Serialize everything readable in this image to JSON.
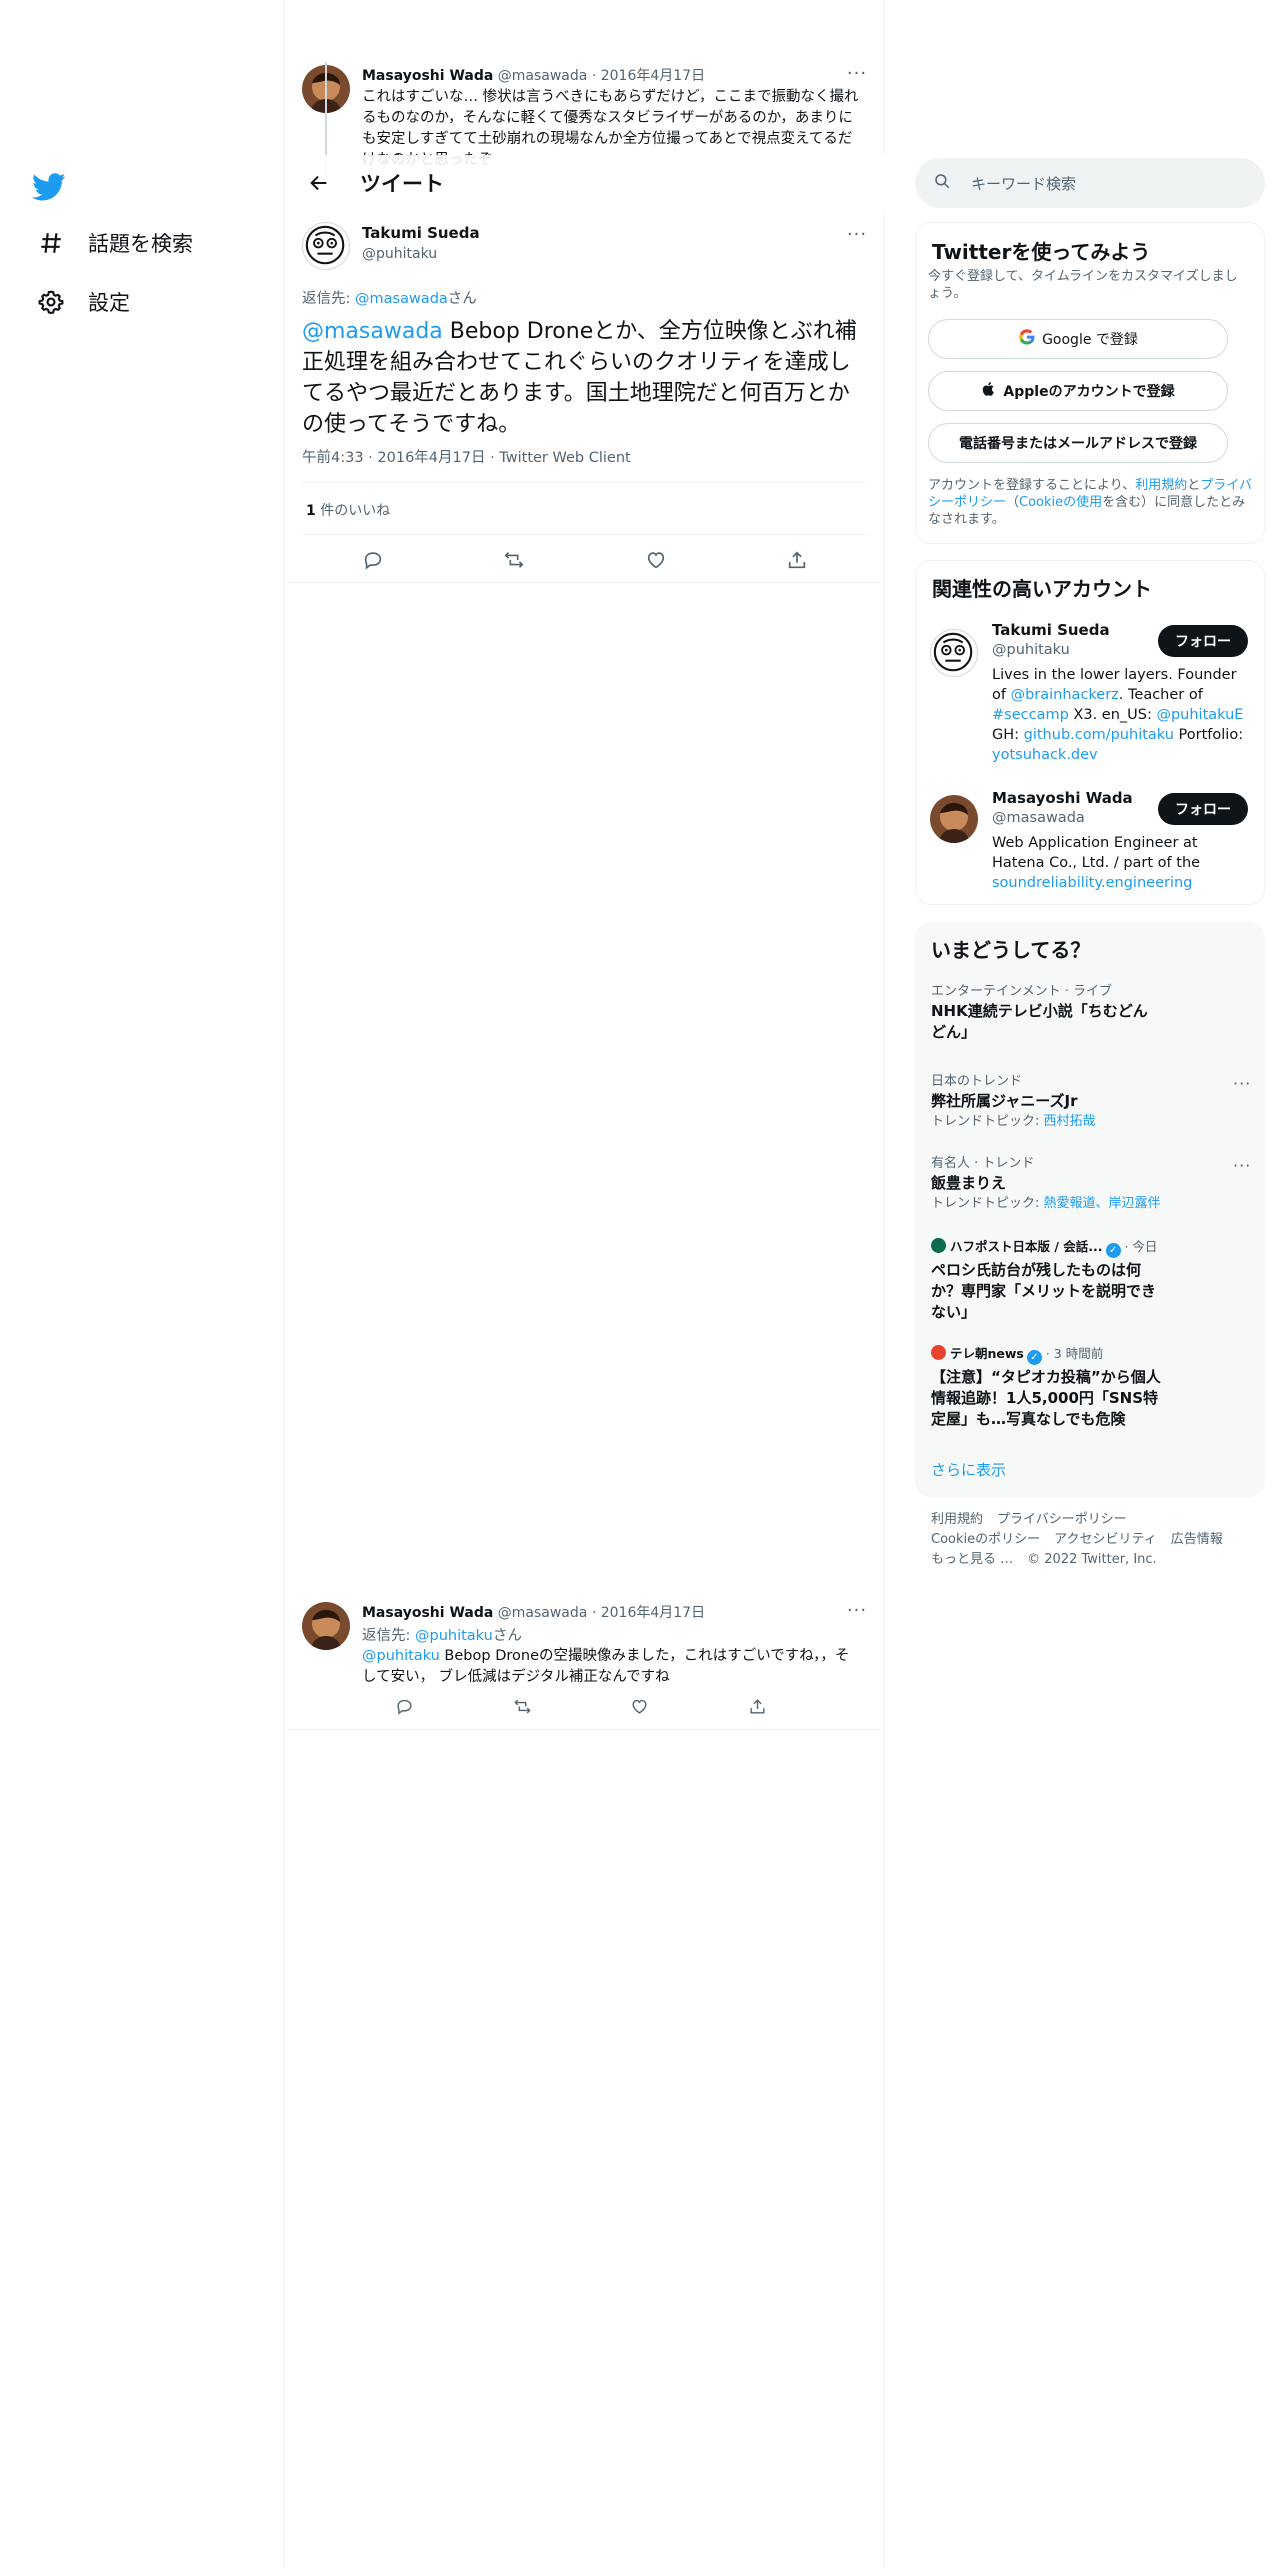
{
  "nav": {
    "explore_label": "話題を検索",
    "settings_label": "設定"
  },
  "parent_tweet": {
    "name": "Masayoshi Wada",
    "handle": "@masawada",
    "dot": "·",
    "date": "2016年4月17日",
    "text": "これはすごいな… 惨状は言うべきにもあらずだけど，ここまで振動なく撮れるものなのか，そんなに軽くて優秀なスタビライザーがあるのか，あまりにも安定しすぎてて土砂崩れの現場なんか全方位撮ってあとで視点変えてるだけなのかと思ったぞ"
  },
  "header": {
    "title": "ツイート"
  },
  "focus_tweet": {
    "name": "Takumi Sueda",
    "handle": "@puhitaku",
    "reply_prefix": "返信先: ",
    "reply_handle": "@masawada",
    "reply_suffix": "さん",
    "mention": "@masawada",
    "text": " Bebop Droneとか、全方位映像とぶれ補正処理を組み合わせてこれぐらいのクオリティを達成してるやつ最近だとあります。国土地理院だと何百万とかの使ってそうですね。",
    "meta": "午前4:33 · 2016年4月17日 · Twitter Web Client",
    "likes_count": "1",
    "likes_label": " 件のいいね"
  },
  "reply_tweet": {
    "name": "Masayoshi Wada",
    "handle": "@masawada",
    "dot": "·",
    "date": "2016年4月17日",
    "reply_prefix": "返信先: ",
    "reply_handle": "@puhitaku",
    "reply_suffix": "さん",
    "mention": "@puhitaku",
    "text": " Bebop Droneの空撮映像みました，これはすごいですね，，そして安い， ブレ低減はデジタル補正なんですね"
  },
  "search": {
    "placeholder": "キーワード検索"
  },
  "signup": {
    "title": "Twitterを使ってみよう",
    "subtitle": "今すぐ登録して、タイムラインをカスタマイズしましょう。",
    "google_label": "Google で登録",
    "apple_label": "Appleのアカウントで登録",
    "phone_label": "電話番号またはメールアドレスで登録",
    "legal_1": "アカウントを登録することにより、",
    "terms_link": "利用規約",
    "legal_2": "と",
    "privacy_link": "プライバシーポリシー",
    "legal_3": "（",
    "cookie_link": "Cookieの使用",
    "legal_4": "を含む）に同意したとみなされます。"
  },
  "related": {
    "title": "関連性の高いアカウント",
    "follow_label": "フォロー",
    "accounts": [
      {
        "name": "Takumi Sueda",
        "handle": "@puhitaku",
        "bio_1": "Lives in the lower layers. Founder of ",
        "bio_link_1": "@brainhackerz",
        "bio_2": ". Teacher of ",
        "bio_link_2": "#seccamp",
        "bio_3": " X3. en_US: ",
        "bio_link_3": "@puhitakuE",
        "bio_4": " GH: ",
        "bio_link_4": "github.com/puhitaku",
        "bio_5": " Portfolio: ",
        "bio_link_5": "yotsuhack.dev"
      },
      {
        "name": "Masayoshi Wada",
        "handle": "@masawada",
        "bio_1": "Web Application Engineer at Hatena Co., Ltd. / part of the ",
        "bio_link_1": "soundreliability.engineering"
      }
    ]
  },
  "trends": {
    "title": "いまどうしてる？",
    "items": [
      {
        "context": "エンターテインメント · ライブ",
        "title": "NHK連続テレビ小説「ちむどんどん」"
      },
      {
        "context": "日本のトレンド",
        "title": "弊社所属ジャニーズJr",
        "topic_prefix": "トレンドトピック: ",
        "topic": "西村拓哉"
      },
      {
        "context": "有名人 · トレンド",
        "title": "飯豊まりえ",
        "topic_prefix": "トレンドトピック: ",
        "topic": "熱愛報道、岸辺露伴"
      },
      {
        "source": "ハフポスト日本版 / 会話...",
        "time": " · 今日",
        "title": "ペロシ氏訪台が残したものは何か？専門家「メリットを説明できない」"
      },
      {
        "source": "テレ朝news",
        "time": " · 3 時間前",
        "title": "【注意】“タピオカ投稿”から個人情報追跡！1人5,000円「SNS特定屋」も…写真なしでも危険"
      }
    ],
    "show_more": "さらに表示"
  },
  "footer": {
    "terms": "利用規約",
    "privacy": "プライバシーポリシー",
    "cookie": "Cookieのポリシー",
    "accessibility": "アクセシビリティ",
    "ads": "広告情報",
    "more": "もっと見る …",
    "copyright": "© 2022 Twitter, Inc."
  },
  "colors": {
    "accent": "#1d9bf0",
    "text": "#0f1419",
    "secondary": "#536471",
    "border": "#eff3f4",
    "button_dark": "#0f1419"
  }
}
